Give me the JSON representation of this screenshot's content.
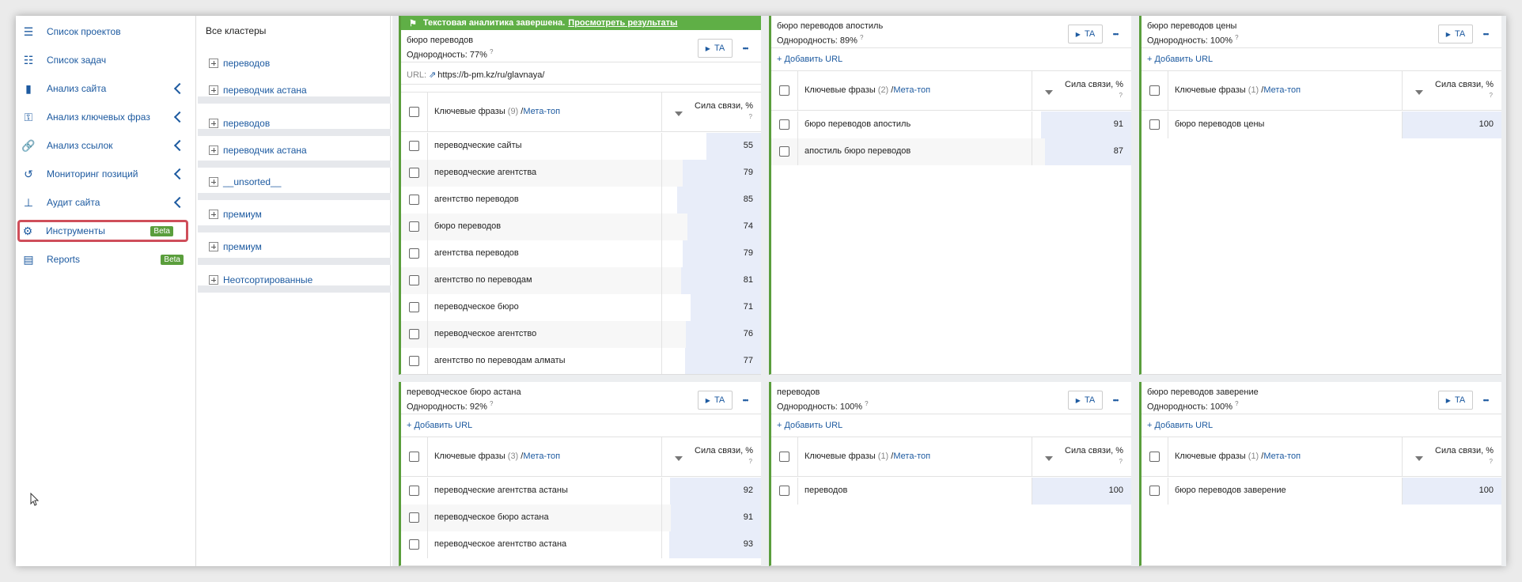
{
  "sidebar": {
    "items": [
      {
        "label": "Список проектов",
        "icon": "menu-icon"
      },
      {
        "label": "Список задач",
        "icon": "list-icon"
      },
      {
        "label": "Анализ сайта",
        "icon": "chart-icon"
      },
      {
        "label": "Анализ ключевых фраз",
        "icon": "key-icon"
      },
      {
        "label": "Анализ ссылок",
        "icon": "link-icon"
      },
      {
        "label": "Мониторинг позиций",
        "icon": "history-icon"
      },
      {
        "label": "Аудит сайта",
        "icon": "sitemap-icon"
      },
      {
        "label": "Инструменты",
        "icon": "gear-icon",
        "badge": "Beta"
      },
      {
        "label": "Reports",
        "icon": "report-icon",
        "badge": "Beta"
      }
    ]
  },
  "clusters": {
    "header": "Все кластеры",
    "items": [
      "переводов",
      "переводчик астана",
      "переводов",
      "переводчик астана",
      "__unsorted__",
      "премиум",
      "премиум",
      "Неотсортированные"
    ]
  },
  "banner": {
    "text": "Текстовая аналитика завершена.",
    "link": "Просмотреть результаты"
  },
  "common": {
    "ta": "TA",
    "add_url": "+ Добавить URL",
    "url_label": "URL:",
    "phrases_label": "Ключевые фразы",
    "meta_top": "Мета-топ",
    "strength": "Сила связи, %",
    "q": "?",
    "homog_label": "Однородность:"
  },
  "cards": [
    {
      "title": "бюро переводов",
      "homog": "77%",
      "count": "(9)",
      "url": "https://b-pm.kz/ru/glavnaya/",
      "rows": [
        {
          "p": "переводческие сайты",
          "v": "55"
        },
        {
          "p": "переводческие агентства",
          "v": "79"
        },
        {
          "p": "агентство переводов",
          "v": "85"
        },
        {
          "p": "бюро переводов",
          "v": "74"
        },
        {
          "p": "агентства переводов",
          "v": "79"
        },
        {
          "p": "агентство по переводам",
          "v": "81"
        },
        {
          "p": "переводческое бюро",
          "v": "71"
        },
        {
          "p": "переводческое агентство",
          "v": "76"
        },
        {
          "p": "агентство по переводам алматы",
          "v": "77"
        }
      ]
    },
    {
      "title": "бюро переводов апостиль",
      "homog": "89%",
      "count": "(2)",
      "rows": [
        {
          "p": "бюро переводов апостиль",
          "v": "91"
        },
        {
          "p": "апостиль бюро переводов",
          "v": "87"
        }
      ]
    },
    {
      "title": "бюро переводов цены",
      "homog": "100%",
      "count": "(1)",
      "rows": [
        {
          "p": "бюро переводов цены",
          "v": "100"
        }
      ]
    },
    {
      "title": "переводческое бюро астана",
      "homog": "92%",
      "count": "(3)",
      "rows": [
        {
          "p": "переводческие агентства астаны",
          "v": "92"
        },
        {
          "p": "переводческое бюро астана",
          "v": "91"
        },
        {
          "p": "переводческое агентство астана",
          "v": "93"
        }
      ]
    },
    {
      "title": "переводов",
      "homog": "100%",
      "count": "(1)",
      "rows": [
        {
          "p": "переводов",
          "v": "100"
        }
      ]
    },
    {
      "title": "бюро переводов заверение",
      "homog": "100%",
      "count": "(1)",
      "rows": [
        {
          "p": "бюро переводов заверение",
          "v": "100"
        }
      ]
    }
  ]
}
